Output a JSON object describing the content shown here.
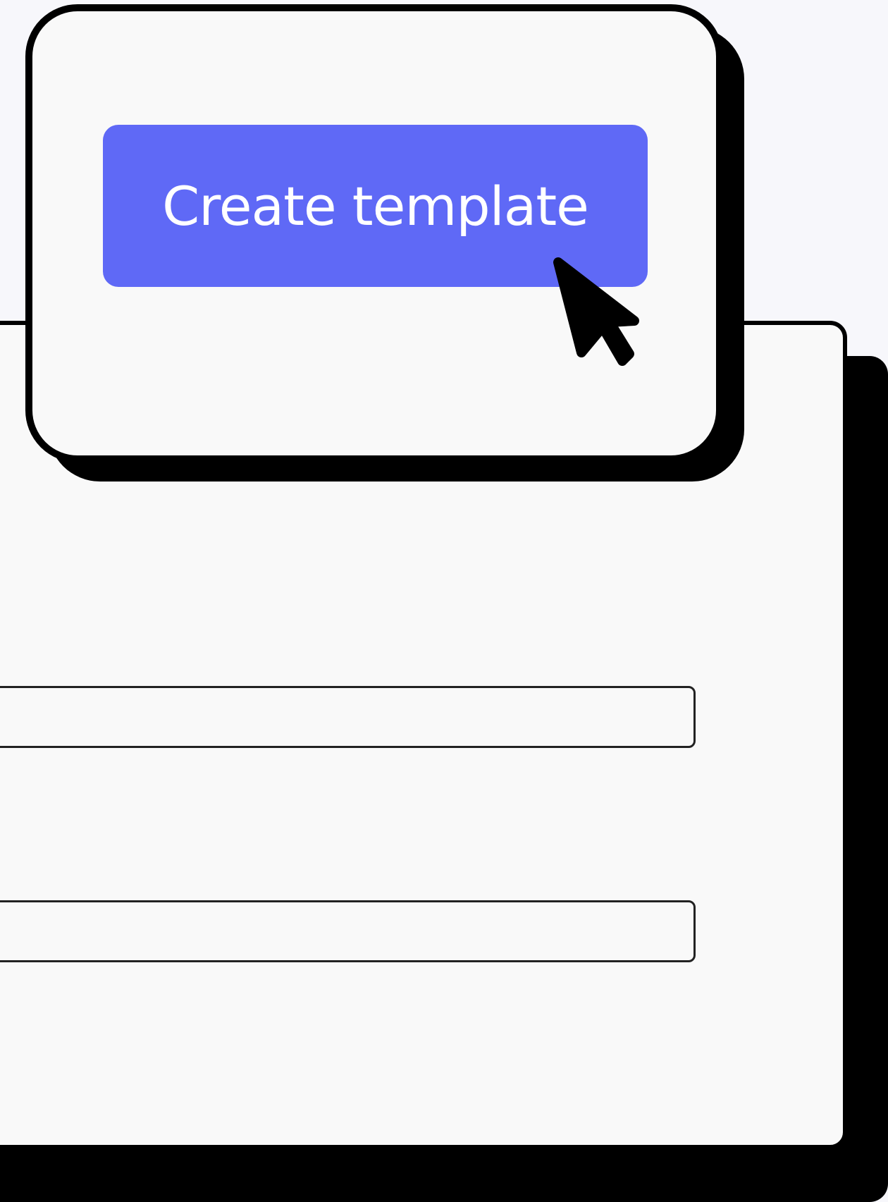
{
  "popup": {
    "primary_button": {
      "label": "Create template"
    }
  },
  "icons": {
    "pointer": "mouse-pointer-icon"
  },
  "colors": {
    "background": "#f7f7fb",
    "card": "#f9f9f9",
    "outline": "#000000",
    "button": "#5f69f6",
    "button_text": "#ffffff"
  }
}
